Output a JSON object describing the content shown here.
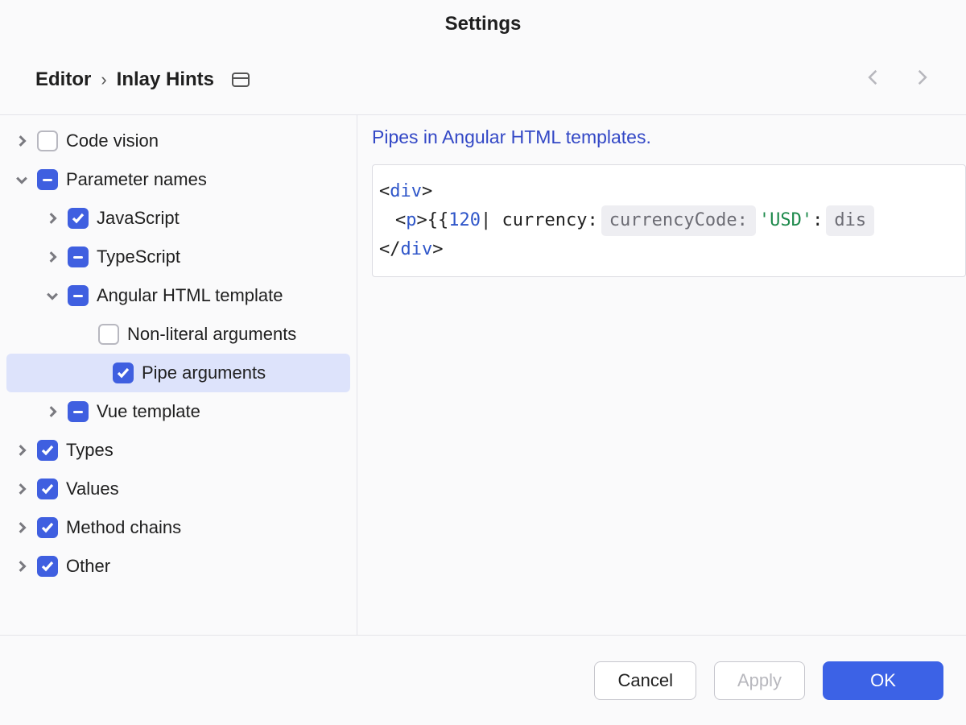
{
  "title": "Settings",
  "breadcrumb": {
    "root": "Editor",
    "leaf": "Inlay Hints"
  },
  "tree": {
    "code_vision": "Code vision",
    "parameter_names": "Parameter names",
    "javascript": "JavaScript",
    "typescript": "TypeScript",
    "angular_html_template": "Angular HTML template",
    "non_literal_arguments": "Non-literal arguments",
    "pipe_arguments": "Pipe arguments",
    "vue_template": "Vue template",
    "types": "Types",
    "values": "Values",
    "method_chains": "Method chains",
    "other": "Other"
  },
  "content": {
    "description": "Pipes in Angular HTML templates.",
    "code": {
      "tag_div": "div",
      "tag_p": "p",
      "open_interp": "{{",
      "value": "120",
      "pipe_kw": " | currency: ",
      "hint_currencyCode": "currencyCode:",
      "str_usd": "'USD'",
      "colon2": " : ",
      "hint_dis": "dis"
    }
  },
  "footer": {
    "cancel": "Cancel",
    "apply": "Apply",
    "ok": "OK"
  }
}
